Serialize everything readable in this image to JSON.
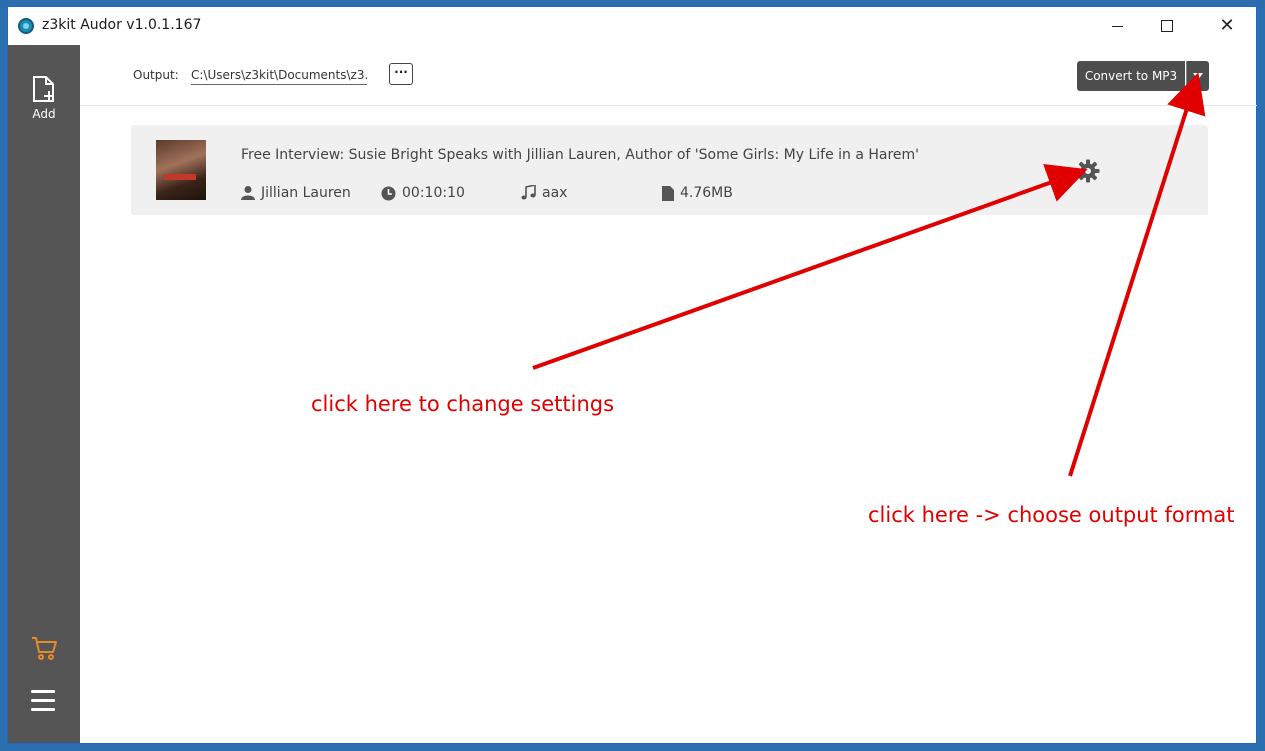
{
  "window": {
    "title": "z3kit Audor v1.0.1.167",
    "controls": {
      "minimize": "minimize",
      "maximize": "maximize",
      "close": "✕"
    }
  },
  "sidebar": {
    "add_label": "Add",
    "icons": [
      "add-file-icon",
      "cart-icon",
      "menu-icon"
    ],
    "cart_color": "#e8892b"
  },
  "toolbar": {
    "output_label": "Output:",
    "output_path": "C:\\Users\\z3kit\\Documents\\z3...",
    "browse_label": "···",
    "convert_label": "Convert to MP3"
  },
  "items": [
    {
      "title": "Free Interview: Susie Bright Speaks with Jillian Lauren, Author of 'Some Girls: My Life in a Harem'",
      "author": "Jillian Lauren",
      "duration": "00:10:10",
      "format": "aax",
      "size": "4.76MB"
    }
  ],
  "annotations": {
    "settings": "click here to change settings",
    "format": "click here -> choose output format",
    "color": "#e00000"
  }
}
